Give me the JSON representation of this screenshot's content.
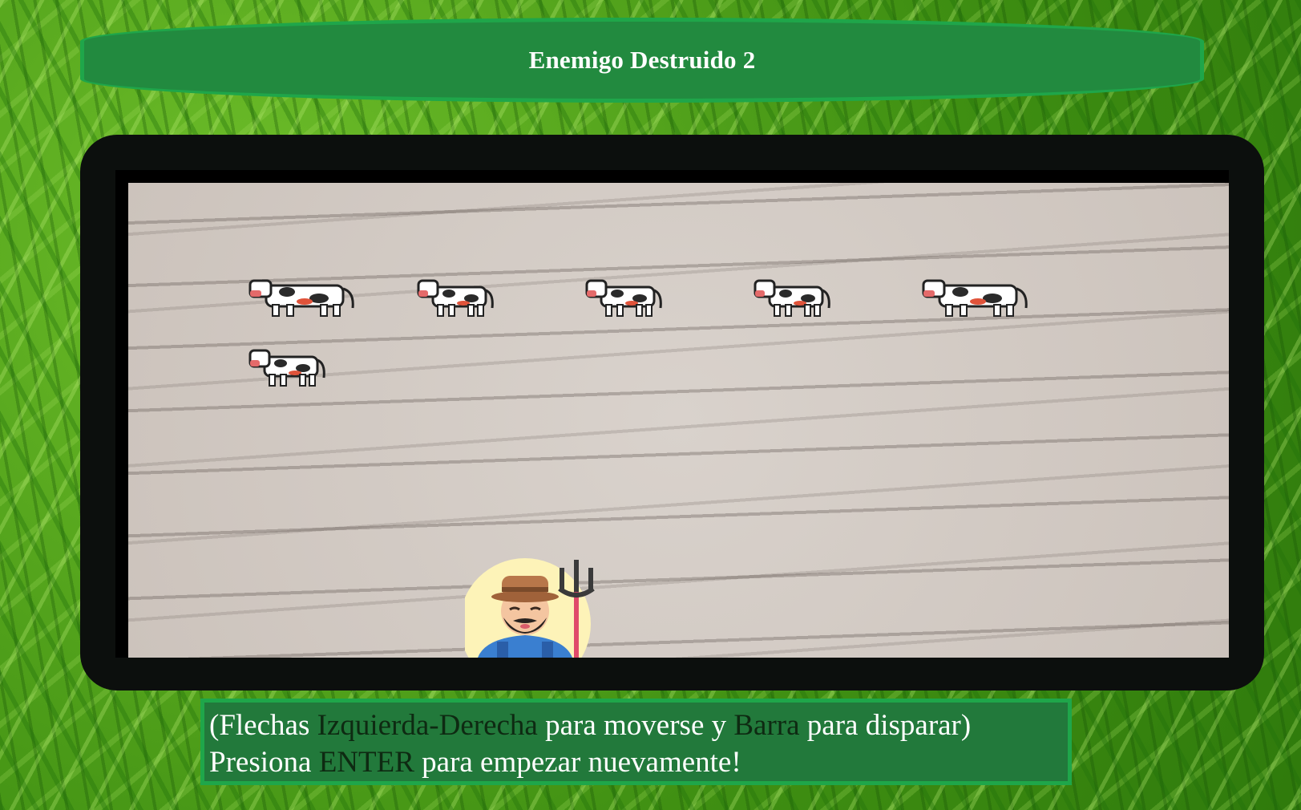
{
  "header": {
    "score_label": "Enemigo Destruido 2"
  },
  "game": {
    "enemies": [
      {
        "name": "cow-enemy",
        "sprite": "cow-icon"
      },
      {
        "name": "cow-enemy",
        "sprite": "cow-icon"
      },
      {
        "name": "cow-enemy",
        "sprite": "cow-icon"
      },
      {
        "name": "cow-enemy",
        "sprite": "cow-icon"
      },
      {
        "name": "cow-enemy",
        "sprite": "cow-icon"
      },
      {
        "name": "cow-enemy",
        "sprite": "cow-icon"
      }
    ],
    "player": {
      "sprite": "farmer-with-pitchfork-icon"
    }
  },
  "instructions": {
    "line1_open": "(Flechas ",
    "line1_keys": "Izquierda-Derecha",
    "line1_mid": " para moverse y ",
    "line1_fire": "Barra",
    "line1_end": " para disparar)",
    "line2_start": "Presiona ",
    "line2_key": "ENTER",
    "line2_end": " para empezar nuevamente!"
  },
  "colors": {
    "banner": "#228a3f",
    "banner_border": "#1fa64a",
    "frame": "#0c0f0d",
    "highlight_text": "#0e2a12"
  }
}
